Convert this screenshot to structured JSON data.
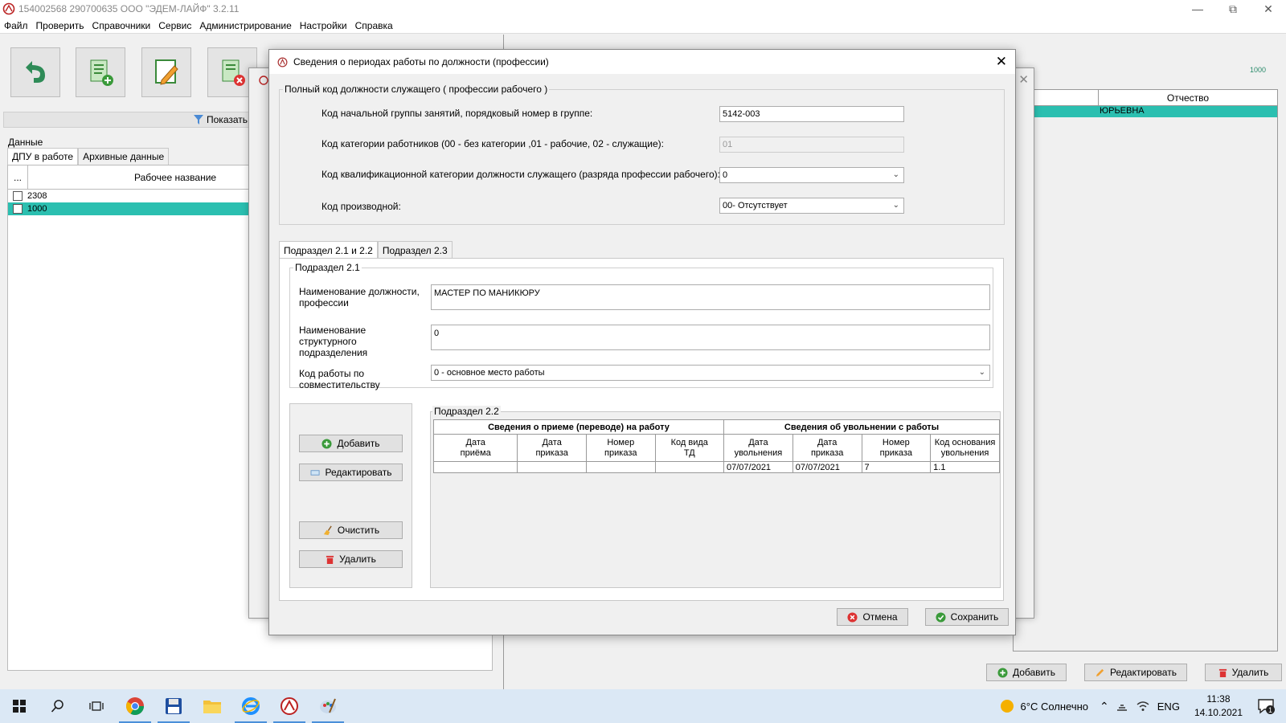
{
  "window": {
    "title": "154002568 290700635 ООО \"ЭДЕМ-ЛАЙФ\" 3.2.11"
  },
  "menu": [
    "Файл",
    "Проверить",
    "Справочники",
    "Сервис",
    "Администрирование",
    "Настройки",
    "Справка"
  ],
  "left": {
    "filter_label": "Показать п",
    "data_label": "Данные",
    "tabs": [
      "ДПУ в работе",
      "Архивные данные"
    ],
    "grid_header_dots": "...",
    "grid_header": "Рабочее название",
    "rows": [
      "2308",
      "1000"
    ]
  },
  "right": {
    "small_value": "1000",
    "col_header": "Отчество",
    "row_value": "ЮРЬЕВНА",
    "buttons": {
      "add": "Добавить",
      "edit": "Редактировать",
      "delete": "Удалить"
    }
  },
  "dialog": {
    "title": "Сведения о периодах работы по должности (профессии)",
    "group1": "Полный код должности служащего ( профессии рабочего )",
    "f1_label": "Код начальной группы занятий, порядковый номер в группе:",
    "f1_value": "5142-003",
    "f2_label": "Код категории работников (00 - без категории ,01 - рабочие, 02 - служащие):",
    "f2_value": "01",
    "f3_label": "Код квалификационной категории должности служащего (разряда профессии рабочего):",
    "f3_value": "0",
    "f4_label": "Код производной:",
    "f4_value": "00- Отсутствует",
    "tabs": [
      "Подраздел 2.1 и 2.2",
      "Подраздел 2.3"
    ],
    "sub21": "Подраздел 2.1",
    "pos_label": "Наименование должности, профессии",
    "pos_value": "МАСТЕР ПО МАНИКЮРУ",
    "dept_label": "Наименование структурного подразделения",
    "dept_value": "0",
    "combo_label": "Код работы по совместительству",
    "combo_value": "0 - основное место работы",
    "sub22": "Подраздел 2.2",
    "buttons": {
      "add": "Добавить",
      "edit": "Редактировать",
      "clear": "Очистить",
      "delete": "Удалить",
      "cancel": "Отмена",
      "save": "Сохранить"
    },
    "table": {
      "group_hire": "Сведения о приеме (переводе) на работу",
      "group_fire": "Сведения об увольнении с работы",
      "columns": [
        [
          "Дата",
          "приёма"
        ],
        [
          "Дата",
          "приказа"
        ],
        [
          "Номер",
          "приказа"
        ],
        [
          "Код вида",
          "ТД"
        ],
        [
          "Дата",
          "увольнения"
        ],
        [
          "Дата",
          "приказа"
        ],
        [
          "Номер",
          "приказа"
        ],
        [
          "Код основания",
          "увольнения"
        ]
      ],
      "row": [
        "",
        "",
        "",
        "",
        "07/07/2021",
        "07/07/2021",
        "7",
        "1.1"
      ]
    }
  },
  "taskbar": {
    "weather": "6°C  Солнечно",
    "lang": "ENG",
    "time": "11:38",
    "date": "14.10.2021",
    "notif_count": "1"
  }
}
